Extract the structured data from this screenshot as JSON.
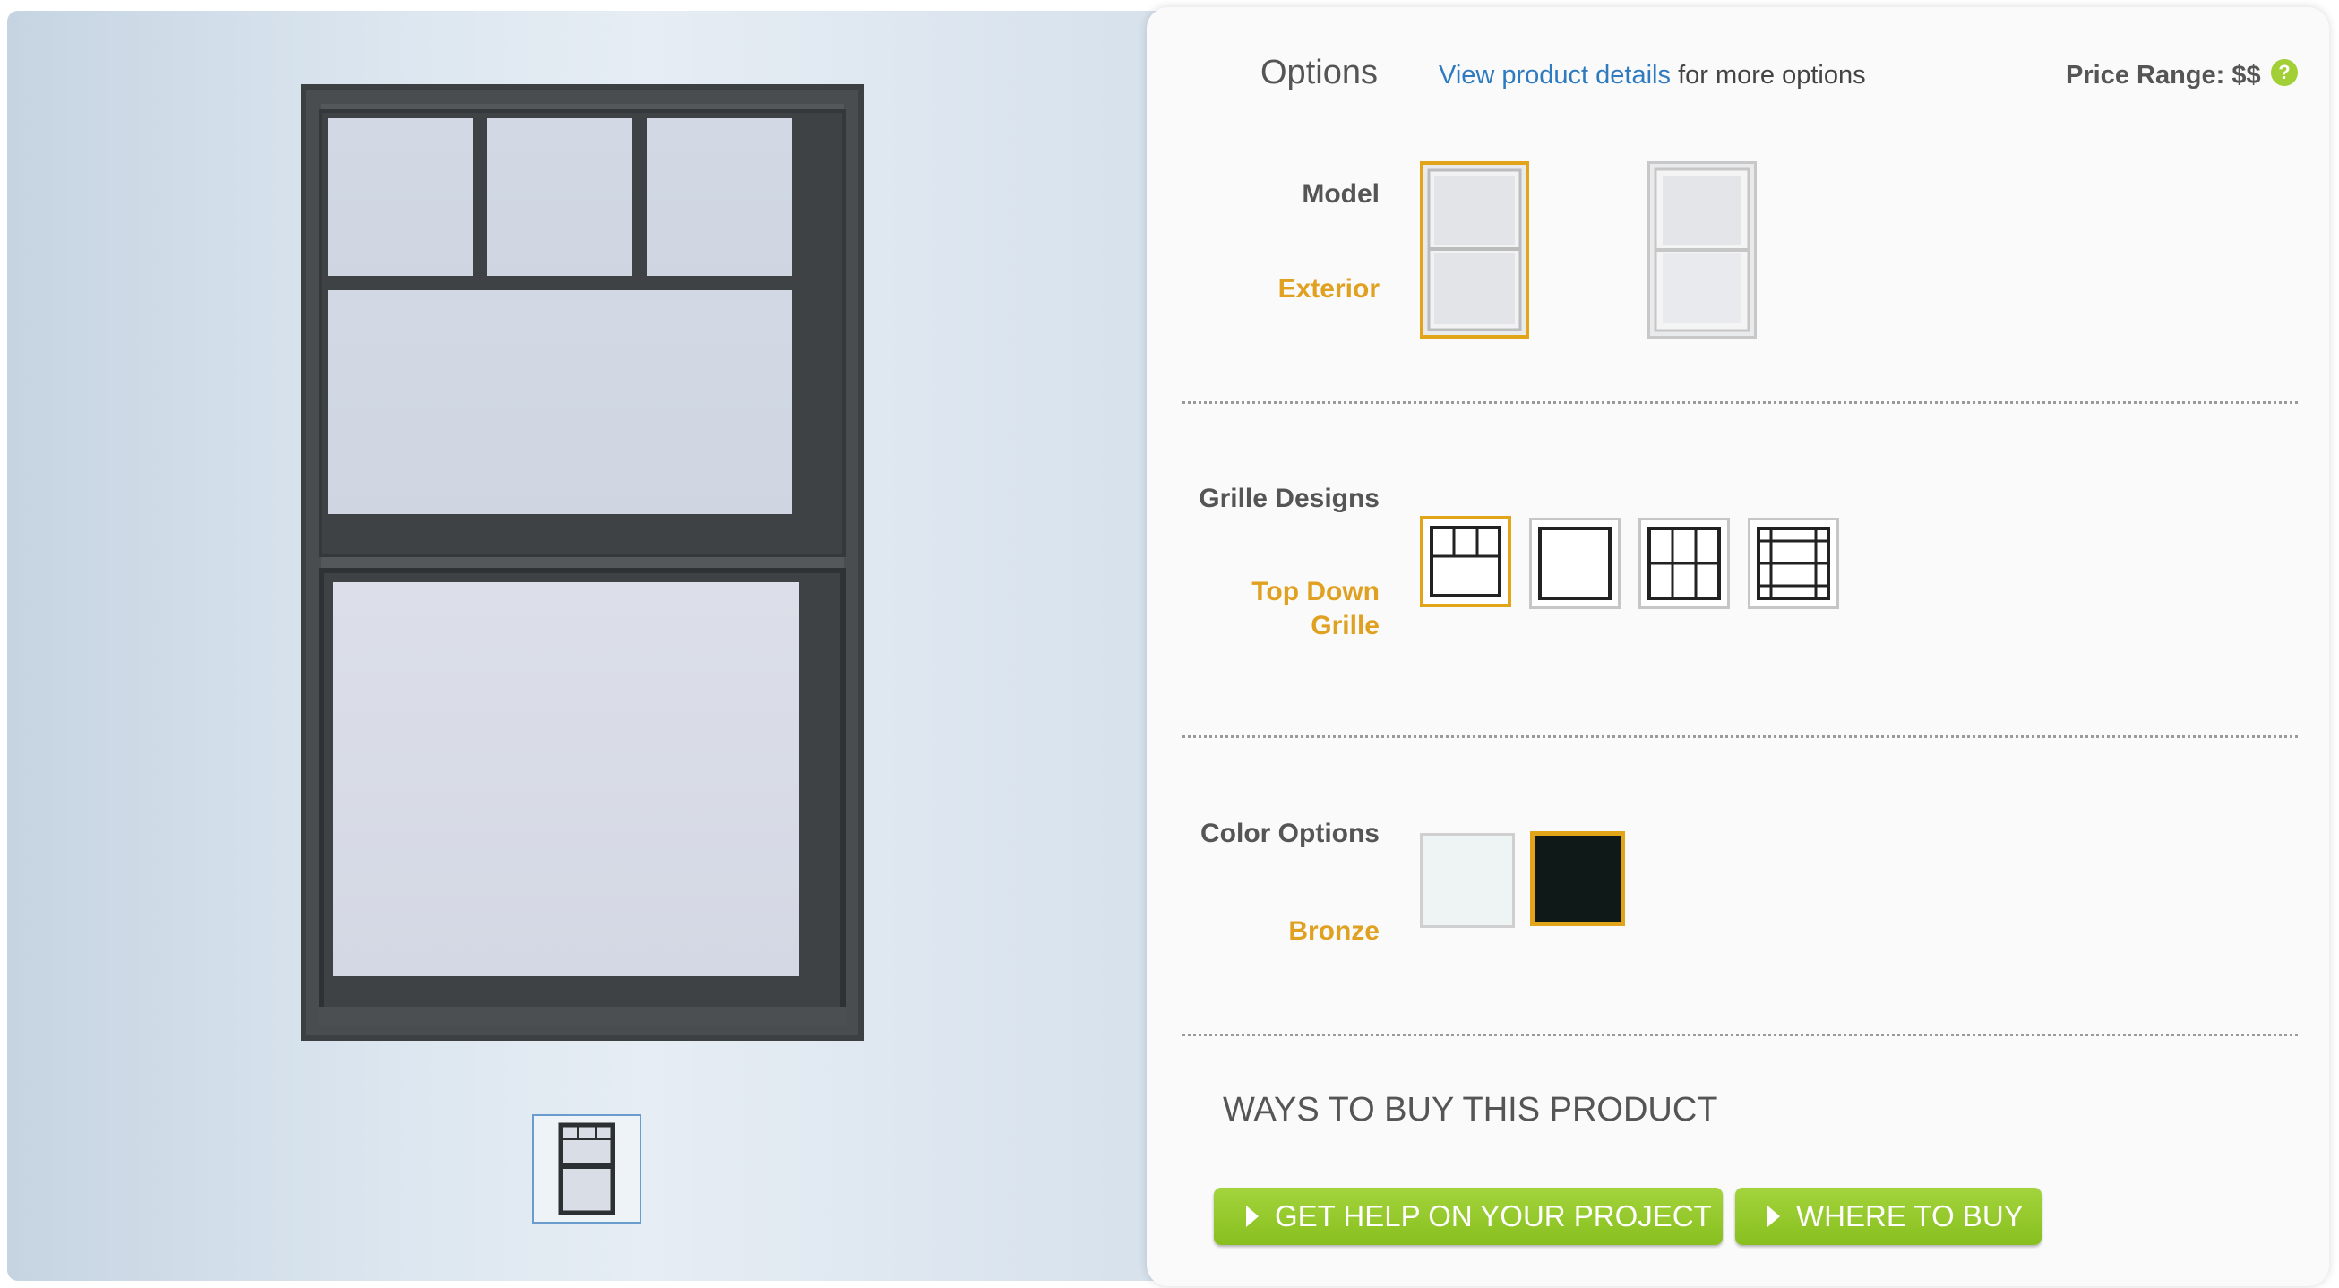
{
  "options": {
    "title": "Options",
    "details_link": "View product details",
    "details_suffix": "for more options",
    "price_label": "Price Range: $$",
    "help_glyph": "?"
  },
  "model": {
    "label": "Model",
    "selected": "Exterior"
  },
  "grille": {
    "label": "Grille Designs",
    "selected_line1": "Top Down",
    "selected_line2": "Grille"
  },
  "color": {
    "label": "Color Options",
    "selected": "Bronze",
    "swatches": [
      "#eef4f3",
      "#0f1a18"
    ],
    "accent": "#e2a419"
  },
  "buy": {
    "heading": "WAYS TO BUY THIS PRODUCT",
    "help_button": "GET HELP ON YOUR PROJECT",
    "where_button": "WHERE TO BUY"
  }
}
